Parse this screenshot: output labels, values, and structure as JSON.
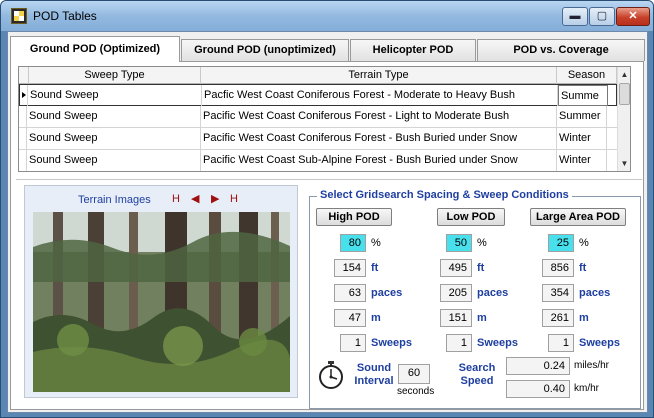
{
  "window": {
    "title": "POD Tables",
    "min_label": "▬",
    "max_label": "▢",
    "close_label": "✕"
  },
  "tabs": [
    {
      "label": "Ground POD (Optimized)",
      "active": true
    },
    {
      "label": "Ground POD (unoptimized)"
    },
    {
      "label": "Helicopter POD"
    },
    {
      "label": "POD vs. Coverage"
    }
  ],
  "table": {
    "columns": [
      "Sweep Type",
      "Terrain Type",
      "Season"
    ],
    "rows": [
      {
        "sweep": "Sound Sweep",
        "terrain": "Pacfic West Coast Coniferous Forest - Moderate to Heavy Bush",
        "season": "Summe"
      },
      {
        "sweep": "Sound Sweep",
        "terrain": "Pacific West Coast Coniferous Forest - Light to Moderate Bush",
        "season": "Summer"
      },
      {
        "sweep": "Sound Sweep",
        "terrain": "Pacific West Coast Coniferous Forest - Bush Buried under Snow",
        "season": "Winter"
      },
      {
        "sweep": "Sound Sweep",
        "terrain": "Pacific West Coast Sub-Alpine Forest - Bush Buried under Snow",
        "season": "Winter"
      }
    ]
  },
  "terrain_images": {
    "title": "Terrain Images",
    "nav": {
      "first": "H",
      "prev": "◀",
      "next": "▶",
      "last": "H"
    }
  },
  "gridsearch": {
    "title": "Select Gridsearch Spacing & Sweep Conditions",
    "columns": [
      {
        "button": "High POD",
        "percent": "80",
        "ft": "154",
        "paces": "63",
        "m": "47",
        "sweeps": "1"
      },
      {
        "button": "Low POD",
        "percent": "50",
        "ft": "495",
        "paces": "205",
        "m": "151",
        "sweeps": "1"
      },
      {
        "button": "Large Area POD",
        "percent": "25",
        "ft": "856",
        "paces": "354",
        "m": "261",
        "sweeps": "1"
      }
    ],
    "units": {
      "percent": "%",
      "ft": "ft",
      "paces": "paces",
      "m": "m",
      "sweeps": "Sweeps"
    },
    "sound_interval": {
      "label_line1": "Sound",
      "label_line2": "Interval",
      "value": "60",
      "unit": "seconds"
    },
    "search_speed": {
      "label_line1": "Search",
      "label_line2": "Speed",
      "miles_value": "0.24",
      "miles_unit": "miles/hr",
      "km_value": "0.40",
      "km_unit": "km/hr"
    }
  },
  "colors": {
    "accent_blue": "#1e3fa0",
    "highlight_cyan": "#48e0ec",
    "titlebar": "#93b9e0"
  }
}
